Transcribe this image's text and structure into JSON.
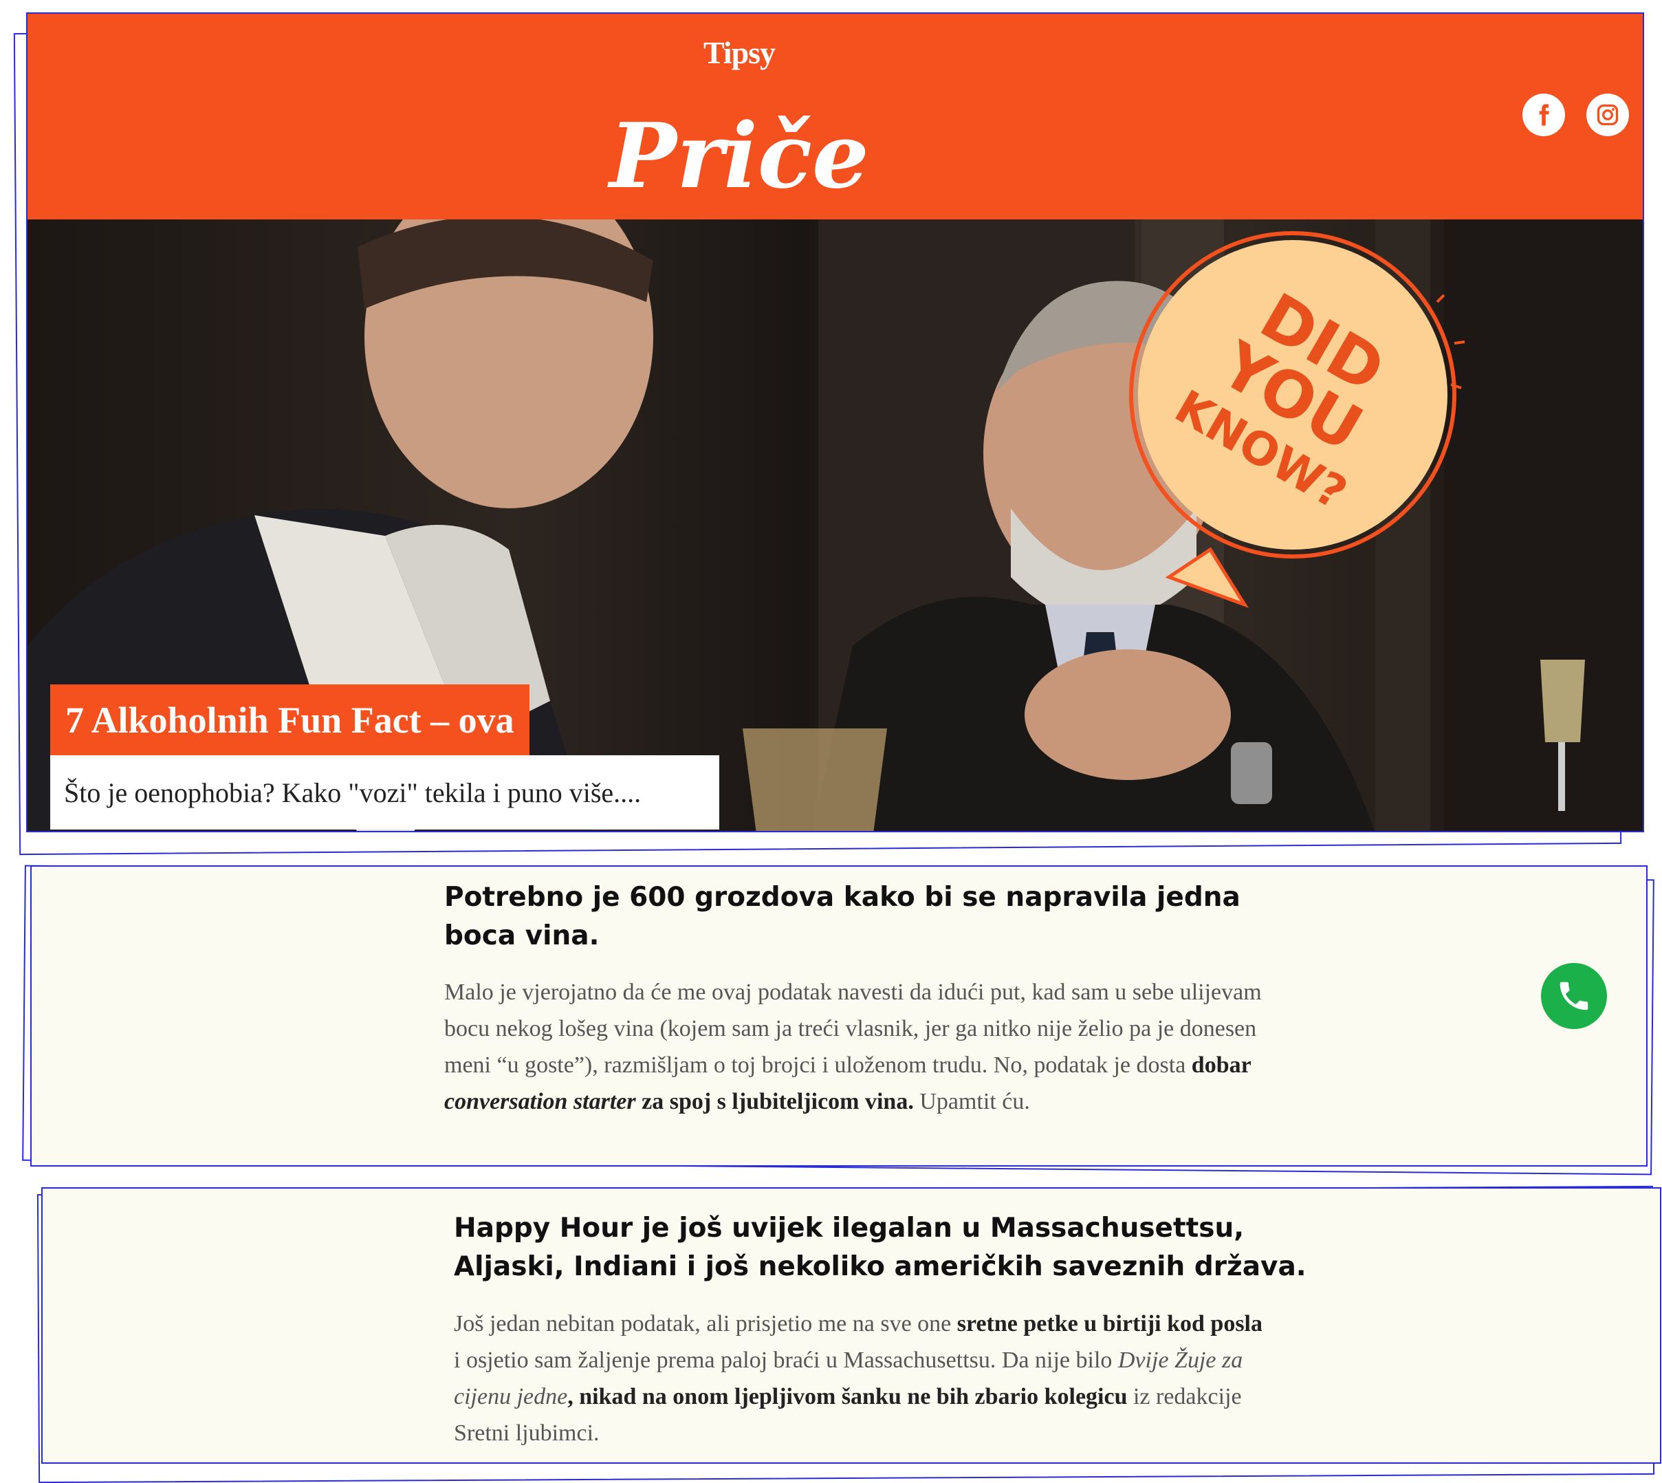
{
  "header": {
    "brand": "Tipsy",
    "section_title": "Priče",
    "social": [
      {
        "name": "facebook",
        "icon": "facebook-icon"
      },
      {
        "name": "instagram",
        "icon": "instagram-icon"
      }
    ]
  },
  "hero": {
    "badge_lines": [
      "DID",
      "YOU",
      "KNOW?"
    ],
    "article_title": "7 Alkoholnih Fun Fact – ova",
    "article_subtitle": "Što je oenophobia? Kako \"vozi\" tekila i puno više...."
  },
  "facts": [
    {
      "heading_lines": [
        "Potrebno je 600 grozdova kako bi se napravila jedna",
        "boca vina."
      ],
      "body": [
        {
          "text": "Malo je vjerojatno da će me ovaj podatak navesti da idući put, kad sam u sebe ulijevam bocu nekog lošeg vina (kojem sam ja treći vlasnik, jer ga nitko nije želio pa je donesen meni “u goste”), razmišljam o toj brojci i uloženom trudu. No, podatak je dosta "
        },
        {
          "text": "dobar ",
          "bold": true
        },
        {
          "text": "conversation starter",
          "bold": true,
          "italic": true
        },
        {
          "text": " za spoj s ljubiteljicom vina.",
          "bold": true
        },
        {
          "text": " Upamtit ću."
        }
      ]
    },
    {
      "heading_lines": [
        "Happy Hour je još uvijek ilegalan u Massachusettsu,",
        "Aljaski, Indiani i još nekoliko američkih saveznih država."
      ],
      "body": [
        {
          "text": "Još jedan nebitan podatak, ali prisjetio me na sve one "
        },
        {
          "text": "sretne petke u birtiji kod posla",
          "bold": true
        },
        {
          "text": " i osjetio sam žaljenje prema paloj braći u Massachusettsu. Da nije bilo "
        },
        {
          "text": "Dvije Žuje za cijenu jedne",
          "italic": true
        },
        {
          "text": ", nikad na onom ljepljivom šanku ne bih zbario kolegicu",
          "bold": true
        },
        {
          "text": " iz redakcije Sretni ljubimci."
        }
      ]
    }
  ],
  "colors": {
    "brand_orange": "#f4511e",
    "call_green": "#1bb04a",
    "panel_bg": "#fcfbf1",
    "badge_fill": "#fcd193"
  },
  "call_button": {
    "icon": "phone-icon"
  }
}
